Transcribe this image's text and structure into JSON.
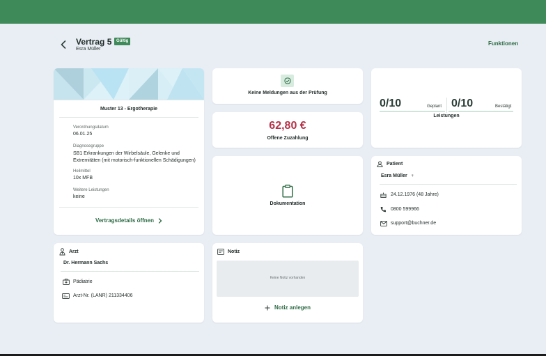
{
  "header": {
    "title": "Vertrag 5",
    "status_badge": "Gültig",
    "subtitle": "Esra Müller",
    "functions_label": "Funktionen"
  },
  "contract_card": {
    "title": "Muster 13 - Ergotherapie",
    "fields": [
      {
        "label": "Verordnungsdatum",
        "value": "06.01.25"
      },
      {
        "label": "Diagnosegruppe",
        "value": "SB1 Erkrankungen der Wirbelsäule, Gelenke und Extremitäten (mit motorisch-funktionellen Schädigungen)"
      },
      {
        "label": "Heilmittel",
        "value": "10x MFB"
      },
      {
        "label": "Weitere Leistungen",
        "value": "keine"
      }
    ],
    "open_details_label": "Vertragsdetails öffnen"
  },
  "check_card": {
    "label": "Keine Meldungen aus der Prüfung"
  },
  "payment_card": {
    "amount": "62,80 €",
    "label": "Offene Zuzahlung"
  },
  "documentation_card": {
    "label": "Dokumentation"
  },
  "services_card": {
    "planned_value": "0/10",
    "planned_label": "Geplant",
    "confirmed_value": "0/10",
    "confirmed_label": "Bestätigt",
    "title": "Leistungen",
    "planned_progress": 0,
    "confirmed_progress": 0
  },
  "patient_card": {
    "section_title": "Patient",
    "name": "Esra Müller",
    "gender_symbol": "♀",
    "birthdate": "24.12.1976 (48 Jahre)",
    "phone": "0800 599966",
    "email": "support@buchner.de"
  },
  "doctor_card": {
    "section_title": "Arzt",
    "name": "Dr. Hermann Sachs",
    "specialty": "Pädiatrie",
    "lanr": "Arzt-Nr. (LANR) 211334406"
  },
  "note_card": {
    "section_title": "Notiz",
    "empty_text": "Keine Notiz vorhanden",
    "add_label": "Notiz anlegen"
  },
  "colors": {
    "topbar": "#3e8a58",
    "accent_green": "#2e6b45",
    "amount_red": "#b5324a",
    "badge_green": "#3e8a58",
    "background": "#e9eef4"
  }
}
